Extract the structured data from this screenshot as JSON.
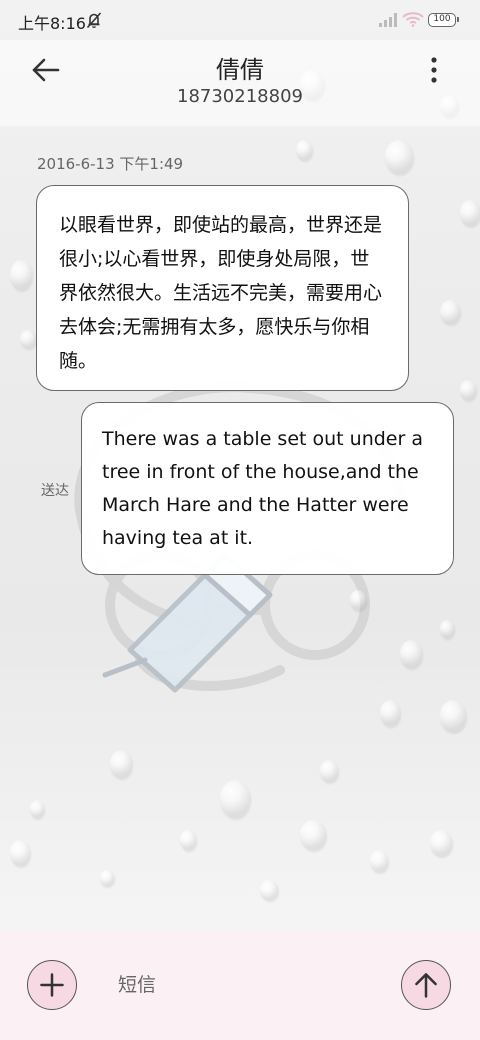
{
  "status_bar": {
    "time": "上午8:16",
    "battery": "100",
    "icons": [
      "mute-icon",
      "signal-icon",
      "wifi-icon",
      "battery-icon"
    ]
  },
  "header": {
    "contact_name": "倩倩",
    "contact_number": "18730218809",
    "back_icon": "arrow-left-icon",
    "more_icon": "more-vertical-icon"
  },
  "conversation": {
    "timestamp": "2016-6-13 下午1:49",
    "messages": [
      {
        "direction": "incoming",
        "text": "以眼看世界，即使站的最高，世界还是很小;以心看世界，即使身处局限，世界依然很大。生活远不完美，需要用心去体会;无需拥有太多，愿快乐与你相随。"
      },
      {
        "direction": "outgoing",
        "text": "There was a table set out under a tree in front of the house,and the March Hare and the Hatter were having tea at it.",
        "status": "送达"
      }
    ]
  },
  "input_bar": {
    "placeholder": "短信",
    "add_icon": "plus-icon",
    "send_icon": "arrow-up-icon"
  },
  "colors": {
    "input_bar_bg": "#fbf1f4",
    "button_fill": "#f7d9e3",
    "bubble_border": "#6a6a6a"
  }
}
